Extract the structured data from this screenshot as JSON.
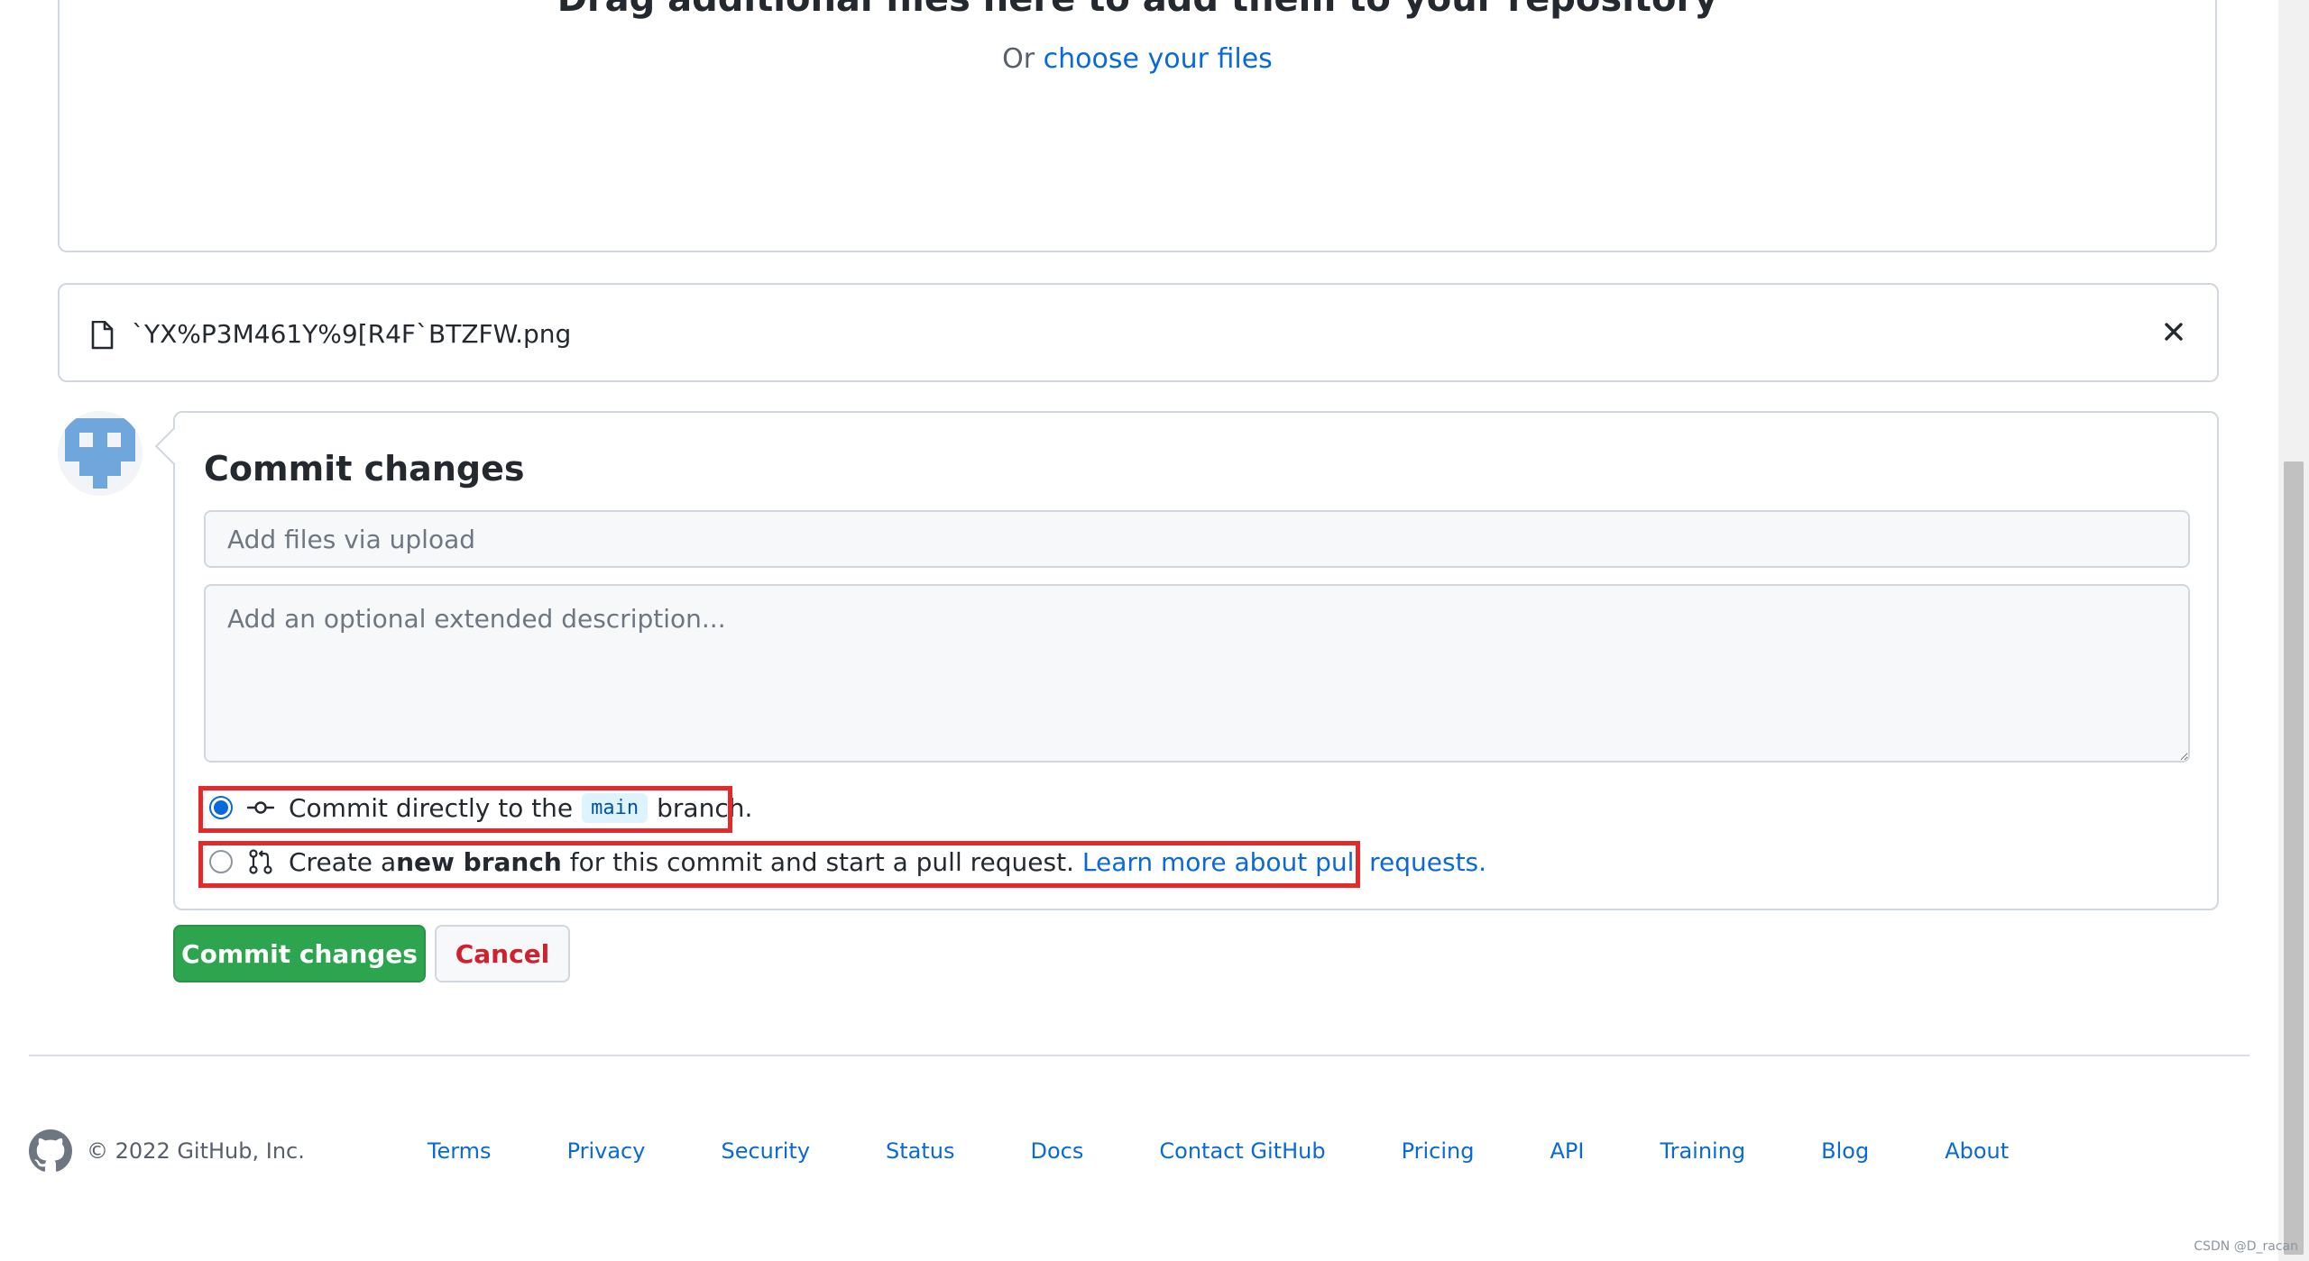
{
  "dropzone": {
    "title": "Drag additional files here to add them to your repository",
    "prefix": "Or ",
    "link": "choose your files"
  },
  "file": {
    "name": "`YX%P3M461Y%9[R4F`BTZFW.png"
  },
  "commit": {
    "title": "Commit changes",
    "summary_placeholder": "Add files via upload",
    "description_placeholder": "Add an optional extended description...",
    "option_direct": {
      "before": "Commit directly to the",
      "branch": "main",
      "after": "branch.",
      "selected": true
    },
    "option_new_branch": {
      "before": "Create a ",
      "bold": "new branch",
      "after": " for this commit and start a pull request. ",
      "link": "Learn more about pull requests.",
      "selected": false
    }
  },
  "buttons": {
    "commit": "Commit changes",
    "cancel": "Cancel"
  },
  "footer": {
    "copyright": "© 2022 GitHub, Inc.",
    "links": [
      "Terms",
      "Privacy",
      "Security",
      "Status",
      "Docs",
      "Contact GitHub",
      "Pricing",
      "API",
      "Training",
      "Blog",
      "About"
    ]
  },
  "watermark": "CSDN @D_racan",
  "colors": {
    "primary_green": "#2da44e",
    "link_blue": "#0969da",
    "danger_red": "#cf222e",
    "highlight_red": "#e5292b"
  }
}
